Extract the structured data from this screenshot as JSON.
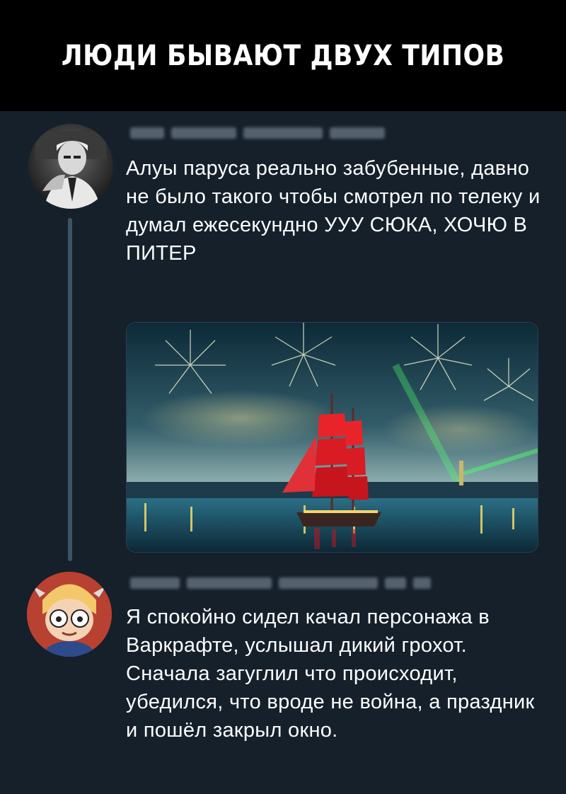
{
  "banner": {
    "title": "ЛЮДИ БЫВАЮТ ДВУХ ТИПОВ"
  },
  "tweets": [
    {
      "text": "Алуы паруса реально забубенные, давно не было такого чтобы смотрел по телеку и думал ежесекундно УУУ СЮКА, ХОЧЮ В ПИТЕР",
      "image_icon": "scarlet-sails-photo"
    },
    {
      "text": "Я спокойно сидел качал персонажа в Варкрафте, услышал дикий грохот. Сначала загуглил что происходит, убедился, что вроде не война, а праздник и пошёл закрыл окно."
    }
  ],
  "colors": {
    "background": "#15202b",
    "banner": "#000000",
    "thread_line": "#3d5466",
    "text": "#ffffff"
  }
}
